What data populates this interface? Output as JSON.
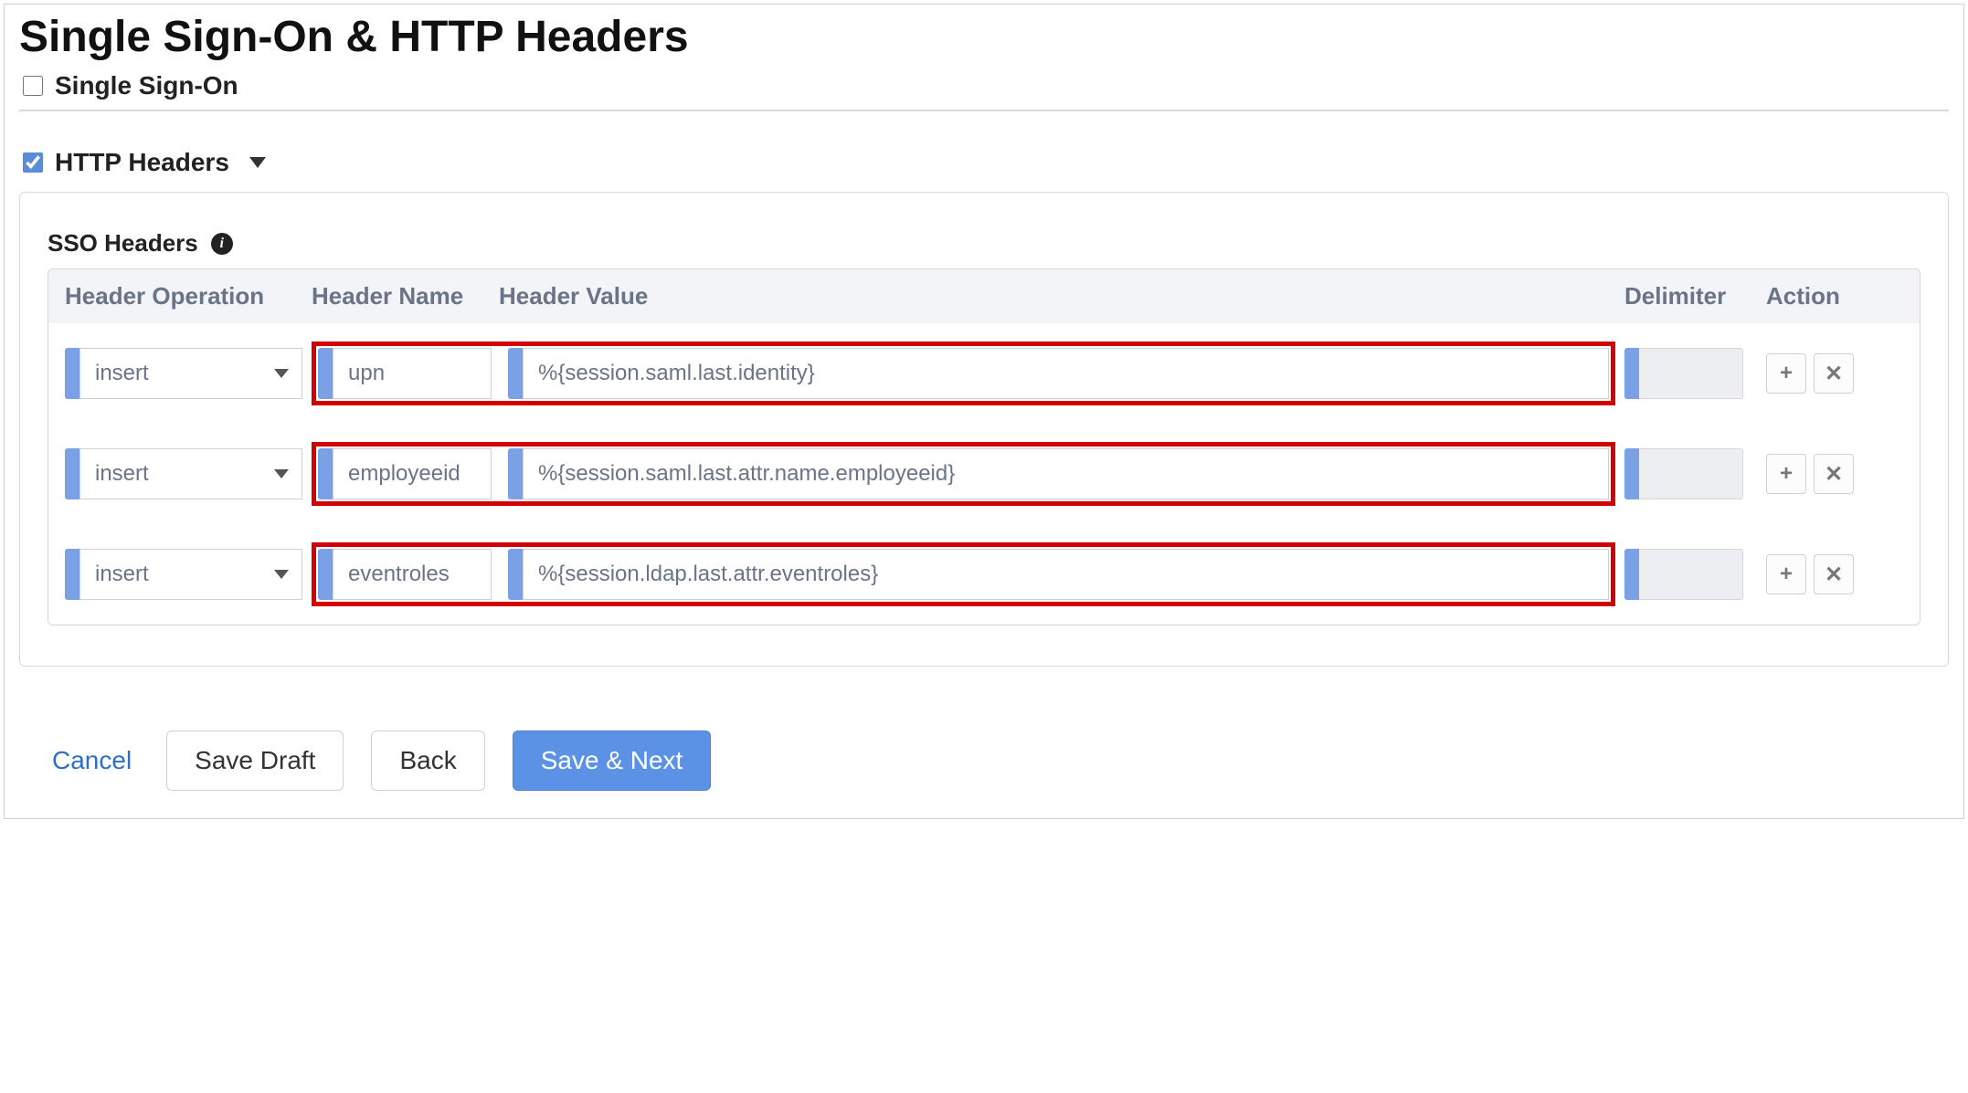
{
  "title": "Single Sign-On & HTTP Headers",
  "sso_checkbox_label": "Single Sign-On",
  "sso_checked": false,
  "http_headers_label": "HTTP Headers",
  "http_headers_checked": true,
  "panel": {
    "sso_headers_label": "SSO Headers",
    "columns": {
      "operation": "Header Operation",
      "name": "Header Name",
      "value": "Header Value",
      "delimiter": "Delimiter",
      "action": "Action"
    },
    "rows": [
      {
        "operation": "insert",
        "name": "upn",
        "value": "%{session.saml.last.identity}",
        "delimiter": ""
      },
      {
        "operation": "insert",
        "name": "employeeid",
        "value": "%{session.saml.last.attr.name.employeeid}",
        "delimiter": ""
      },
      {
        "operation": "insert",
        "name": "eventroles",
        "value": "%{session.ldap.last.attr.eventroles}",
        "delimiter": ""
      }
    ]
  },
  "footer": {
    "cancel": "Cancel",
    "save_draft": "Save Draft",
    "back": "Back",
    "save_next": "Save & Next"
  },
  "icons": {
    "plus": "+",
    "close": "✕"
  }
}
